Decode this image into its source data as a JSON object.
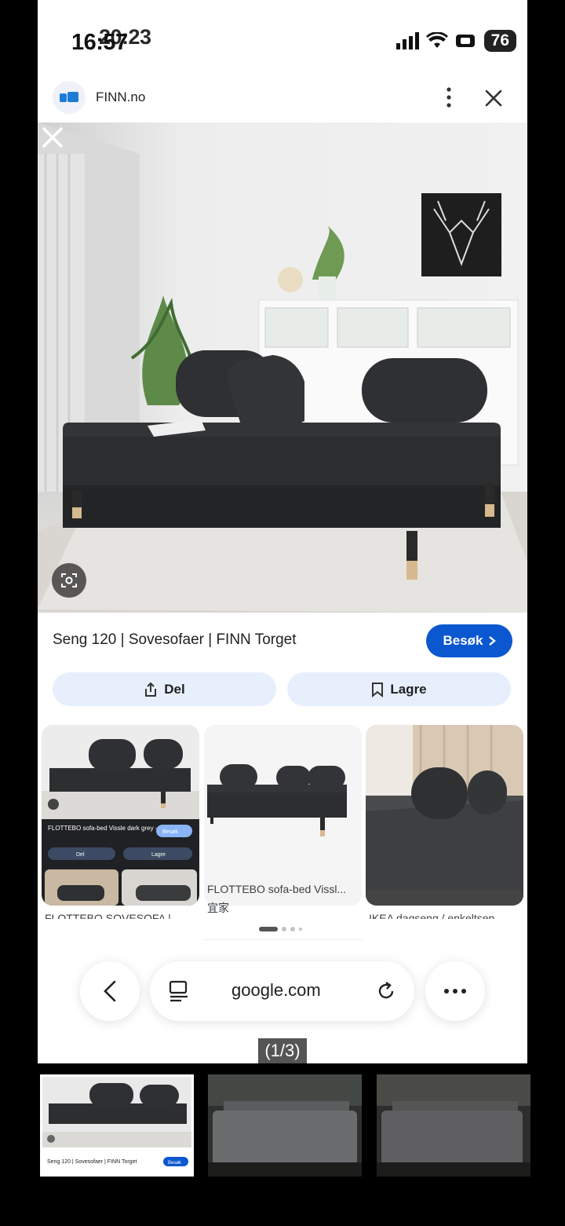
{
  "status_bar": {
    "time_primary": "16:57",
    "time_overlay": "20:23",
    "battery": "76"
  },
  "browser": {
    "site_name": "FINN.no"
  },
  "result": {
    "title": "Seng 120 | Sovesofaer | FINN Torget",
    "visit_label": "Besøk",
    "share_label": "Del",
    "save_label": "Lagre"
  },
  "thumbnails": [
    {
      "caption_cut": "FLOTTEBO SOVESOFA |",
      "inner_title": "FLOTTEBO sofa-bed Vissle dark grey - IKEA",
      "inner_visit": "Besøk",
      "inner_share": "Del",
      "inner_save": "Lagre"
    },
    {
      "caption": "FLOTTEBO sofa-bed Vissl...",
      "source": "宜家"
    },
    {
      "caption_cut": "IKEA dagseng / enkeltsen"
    }
  ],
  "bottom_bar": {
    "url": "google.com"
  },
  "viewer": {
    "counter": "(1/3)"
  },
  "strip": [
    {
      "mini_title": "Seng 120 | Sovesofaer | FINN Torget",
      "mini_visit": "Besøk"
    }
  ],
  "colors": {
    "accent": "#0b57d0",
    "pill_bg": "#e8effc",
    "sofa": "#2b2c2e"
  }
}
